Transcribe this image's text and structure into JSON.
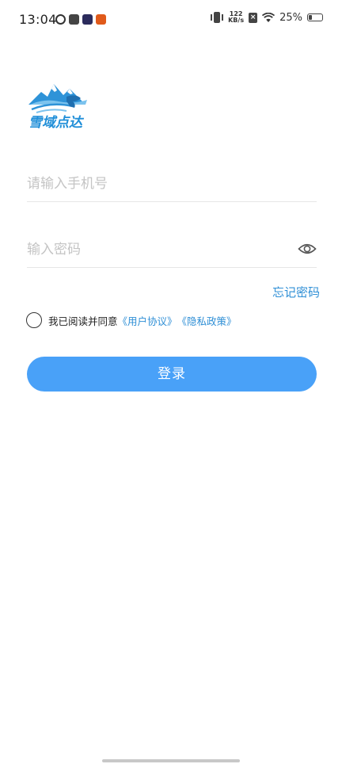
{
  "status_bar": {
    "time": "13:04",
    "net_speed_value": "122",
    "net_speed_unit": "KB/s",
    "sim_label": "×",
    "battery_percent": "25%",
    "battery_level": 0.25,
    "notification_icons": [
      "circle-app-icon",
      "dark-app-icon",
      "media-app-icon",
      "orange-app-icon"
    ]
  },
  "logo": {
    "text": "雪域点达",
    "colors": {
      "primary": "#1f8ed8",
      "mountain": "#2e93d8",
      "light": "#7cc3ee"
    }
  },
  "form": {
    "phone_placeholder": "请输入手机号",
    "phone_value": "",
    "password_placeholder": "输入密码",
    "password_value": "",
    "forgot_label": "忘记密码",
    "agree_prefix": "我已阅读并同意",
    "user_agreement": "《用户协议》",
    "privacy_policy": "《隐私政策》",
    "agreed": false,
    "login_label": "登录"
  },
  "colors": {
    "accent": "#49a1f8",
    "link": "#2f8fd6",
    "placeholder": "#c4c4c4"
  }
}
